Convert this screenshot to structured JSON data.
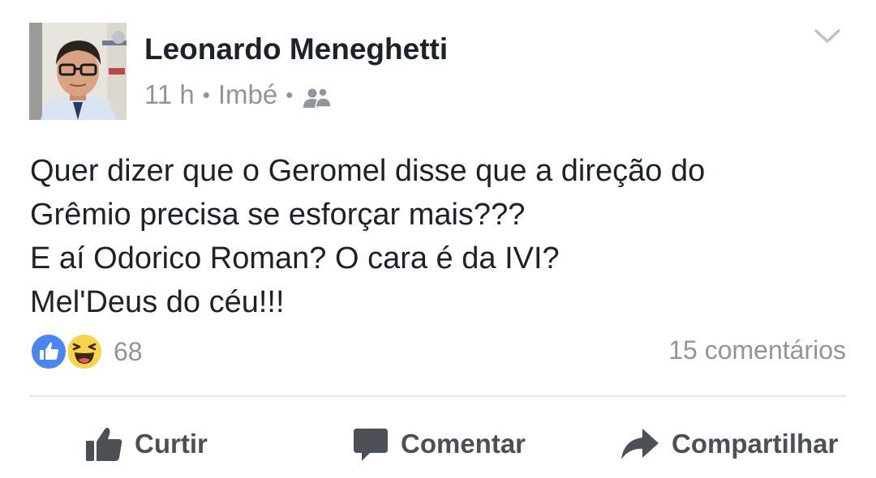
{
  "post": {
    "author": "Leonardo Meneghetti",
    "time": "11 h",
    "location": "Imbé",
    "separator": "•",
    "audience_icon": "friends-icon",
    "menu_icon": "chevron-down-icon",
    "text_lines": [
      "Quer dizer que o Geromel disse que a direção do",
      "Grêmio precisa se esforçar mais???",
      "E aí Odorico Roman? O cara é da IVI?",
      "Mel'Deus do céu!!!"
    ],
    "reactions": {
      "icons": [
        "like-reaction-icon",
        "haha-reaction-icon"
      ],
      "count": "68"
    },
    "comments": "15 comentários"
  },
  "actions": {
    "like": "Curtir",
    "comment": "Comentar",
    "share": "Compartilhar"
  },
  "colors": {
    "primary_text": "#1d2129",
    "secondary_text": "#90949c",
    "action_text": "#4b4f56",
    "like_blue": "#4b85f2",
    "haha_yellow": "#f7d44c",
    "divider": "#e5e6e9"
  }
}
